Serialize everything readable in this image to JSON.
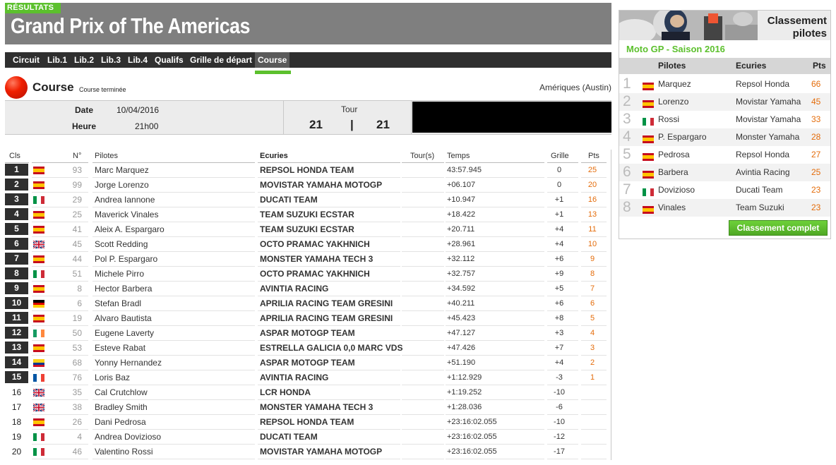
{
  "header": {
    "results_tab": "RÉSULTATS",
    "title": "Grand Prix of The Americas"
  },
  "nav": {
    "items": [
      "Circuit",
      "Lib.1",
      "Lib.2",
      "Lib.3",
      "Lib.4",
      "Qualifs",
      "Grille de départ",
      "Course"
    ],
    "active": "Course"
  },
  "course": {
    "title": "Course",
    "status": "Course terminée",
    "circuit": "Amériques (Austin)",
    "date_label": "Date",
    "date": "10/04/2016",
    "time_label": "Heure",
    "time": "21h00",
    "tour_label": "Tour",
    "tour_current": "21",
    "tour_sep": "|",
    "tour_total": "21"
  },
  "table": {
    "headers": {
      "cls": "Cls",
      "num": "N°",
      "pilot": "Pilotes",
      "team": "Ecuries",
      "tours": "Tour(s)",
      "temps": "Temps",
      "grille": "Grille",
      "pts": "Pts"
    },
    "rows": [
      {
        "cls": "1",
        "flag": "es",
        "num": "93",
        "pilot": "Marc Marquez",
        "team": "REPSOL HONDA TEAM",
        "temps": "43:57.945",
        "grille": "0",
        "pts": "25"
      },
      {
        "cls": "2",
        "flag": "es",
        "num": "99",
        "pilot": "Jorge Lorenzo",
        "team": "MOVISTAR YAMAHA MOTOGP",
        "temps": "+06.107",
        "grille": "0",
        "pts": "20"
      },
      {
        "cls": "3",
        "flag": "it",
        "num": "29",
        "pilot": "Andrea Iannone",
        "team": "DUCATI TEAM",
        "temps": "+10.947",
        "grille": "+1",
        "pts": "16"
      },
      {
        "cls": "4",
        "flag": "es",
        "num": "25",
        "pilot": "Maverick Vinales",
        "team": "TEAM SUZUKI ECSTAR",
        "temps": "+18.422",
        "grille": "+1",
        "pts": "13"
      },
      {
        "cls": "5",
        "flag": "es",
        "num": "41",
        "pilot": "Aleix A. Espargaro",
        "team": "TEAM SUZUKI ECSTAR",
        "temps": "+20.711",
        "grille": "+4",
        "pts": "11"
      },
      {
        "cls": "6",
        "flag": "gb",
        "num": "45",
        "pilot": "Scott Redding",
        "team": "OCTO PRAMAC YAKHNICH",
        "temps": "+28.961",
        "grille": "+4",
        "pts": "10"
      },
      {
        "cls": "7",
        "flag": "es",
        "num": "44",
        "pilot": "Pol P. Espargaro",
        "team": "MONSTER YAMAHA TECH 3",
        "temps": "+32.112",
        "grille": "+6",
        "pts": "9"
      },
      {
        "cls": "8",
        "flag": "it",
        "num": "51",
        "pilot": "Michele Pirro",
        "team": "OCTO PRAMAC YAKHNICH",
        "temps": "+32.757",
        "grille": "+9",
        "pts": "8"
      },
      {
        "cls": "9",
        "flag": "es",
        "num": "8",
        "pilot": "Hector Barbera",
        "team": "AVINTIA RACING",
        "temps": "+34.592",
        "grille": "+5",
        "pts": "7"
      },
      {
        "cls": "10",
        "flag": "de",
        "num": "6",
        "pilot": "Stefan Bradl",
        "team": "APRILIA RACING TEAM GRESINI",
        "temps": "+40.211",
        "grille": "+6",
        "pts": "6"
      },
      {
        "cls": "11",
        "flag": "es",
        "num": "19",
        "pilot": "Alvaro Bautista",
        "team": "APRILIA RACING TEAM GRESINI",
        "temps": "+45.423",
        "grille": "+8",
        "pts": "5"
      },
      {
        "cls": "12",
        "flag": "ie",
        "num": "50",
        "pilot": "Eugene Laverty",
        "team": "ASPAR MOTOGP TEAM",
        "temps": "+47.127",
        "grille": "+3",
        "pts": "4"
      },
      {
        "cls": "13",
        "flag": "es",
        "num": "53",
        "pilot": "Esteve Rabat",
        "team": "ESTRELLA GALICIA 0,0 MARC VDS",
        "temps": "+47.426",
        "grille": "+7",
        "pts": "3"
      },
      {
        "cls": "14",
        "flag": "co",
        "num": "68",
        "pilot": "Yonny Hernandez",
        "team": "ASPAR MOTOGP TEAM",
        "temps": "+51.190",
        "grille": "+4",
        "pts": "2"
      },
      {
        "cls": "15",
        "flag": "fr",
        "num": "76",
        "pilot": "Loris Baz",
        "team": "AVINTIA RACING",
        "temps": "+1:12.929",
        "grille": "-3",
        "pts": "1"
      },
      {
        "cls": "16",
        "flag": "gb",
        "num": "35",
        "pilot": "Cal Crutchlow",
        "team": "LCR HONDA",
        "temps": "+1:19.252",
        "grille": "-10",
        "pts": ""
      },
      {
        "cls": "17",
        "flag": "gb",
        "num": "38",
        "pilot": "Bradley Smith",
        "team": "MONSTER YAMAHA TECH 3",
        "temps": "+1:28.036",
        "grille": "-6",
        "pts": ""
      },
      {
        "cls": "18",
        "flag": "es",
        "num": "26",
        "pilot": "Dani Pedrosa",
        "team": "REPSOL HONDA TEAM",
        "temps": "+23:16:02.055",
        "grille": "-10",
        "pts": ""
      },
      {
        "cls": "19",
        "flag": "it",
        "num": "4",
        "pilot": "Andrea Dovizioso",
        "team": "DUCATI TEAM",
        "temps": "+23:16:02.055",
        "grille": "-12",
        "pts": ""
      },
      {
        "cls": "20",
        "flag": "it",
        "num": "46",
        "pilot": "Valentino Rossi",
        "team": "MOVISTAR YAMAHA MOTOGP",
        "temps": "+23:16:02.055",
        "grille": "-17",
        "pts": ""
      }
    ]
  },
  "standings": {
    "title_line1": "Classement",
    "title_line2": "pilotes",
    "season": "Moto GP - Saison 2016",
    "headers": {
      "pilot": "Pilotes",
      "team": "Ecuries",
      "pts": "Pts"
    },
    "rows": [
      {
        "rank": "1",
        "flag": "es",
        "pilot": "Marquez",
        "team": "Repsol Honda",
        "pts": "66"
      },
      {
        "rank": "2",
        "flag": "es",
        "pilot": "Lorenzo",
        "team": "Movistar Yamaha",
        "pts": "45"
      },
      {
        "rank": "3",
        "flag": "it",
        "pilot": "Rossi",
        "team": "Movistar Yamaha",
        "pts": "33"
      },
      {
        "rank": "4",
        "flag": "es",
        "pilot": "P. Espargaro",
        "team": "Monster Yamaha",
        "pts": "28"
      },
      {
        "rank": "5",
        "flag": "es",
        "pilot": "Pedrosa",
        "team": "Repsol Honda",
        "pts": "27"
      },
      {
        "rank": "6",
        "flag": "es",
        "pilot": "Barbera",
        "team": "Avintia Racing",
        "pts": "25"
      },
      {
        "rank": "7",
        "flag": "it",
        "pilot": "Dovizioso",
        "team": "Ducati Team",
        "pts": "23"
      },
      {
        "rank": "8",
        "flag": "es",
        "pilot": "Vinales",
        "team": "Team Suzuki",
        "pts": "23"
      }
    ],
    "full_button": "Classement complet"
  },
  "colors": {
    "accent_green": "#5cc02d",
    "points_orange": "#e46c0a",
    "header_gray": "#7f7f7f",
    "nav_dark": "#2f2f2f"
  }
}
